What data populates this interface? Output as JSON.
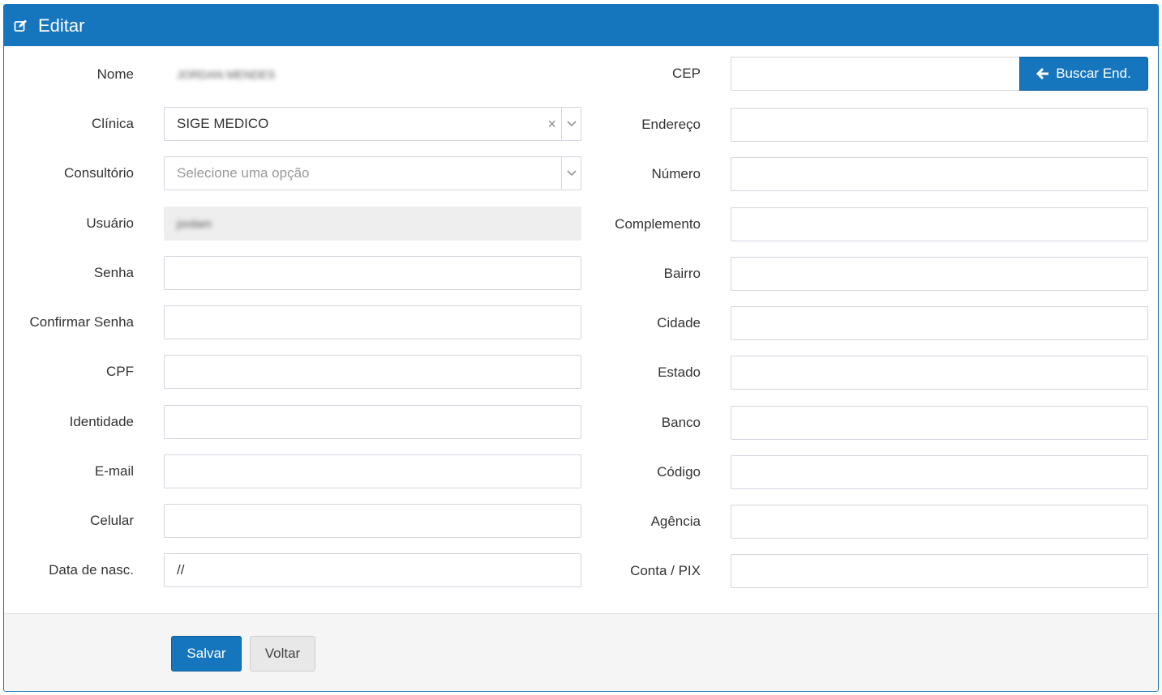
{
  "header": {
    "title": "Editar",
    "icon": "edit-icon"
  },
  "left_fields": [
    {
      "label": "Nome",
      "value": "JORDAN MENDES",
      "type": "text",
      "blurred": true
    },
    {
      "label": "Clínica",
      "value": "SIGE MEDICO",
      "type": "select",
      "clearable": true
    },
    {
      "label": "Consultório",
      "placeholder": "Selecione uma opção",
      "type": "select"
    },
    {
      "label": "Usuário",
      "value": "jordam",
      "type": "readonly",
      "blurred": true
    },
    {
      "label": "Senha",
      "value": "",
      "type": "password"
    },
    {
      "label": "Confirmar Senha",
      "value": "",
      "type": "password"
    },
    {
      "label": "CPF",
      "value": "",
      "type": "text"
    },
    {
      "label": "Identidade",
      "value": "",
      "type": "text"
    },
    {
      "label": "E-mail",
      "value": "",
      "type": "text"
    },
    {
      "label": "Celular",
      "value": "",
      "type": "text"
    },
    {
      "label": "Data de nasc.",
      "value": "//",
      "type": "text"
    }
  ],
  "right_fields": [
    {
      "label": "CEP",
      "value": "",
      "type": "cep"
    },
    {
      "label": "Endereço",
      "value": ""
    },
    {
      "label": "Número",
      "value": ""
    },
    {
      "label": "Complemento",
      "value": ""
    },
    {
      "label": "Bairro",
      "value": ""
    },
    {
      "label": "Cidade",
      "value": ""
    },
    {
      "label": "Estado",
      "value": ""
    },
    {
      "label": "Banco",
      "value": ""
    },
    {
      "label": "Código",
      "value": ""
    },
    {
      "label": "Agência",
      "value": ""
    },
    {
      "label": "Conta / PIX",
      "value": ""
    }
  ],
  "cep_button": {
    "label": "Buscar End.",
    "icon": "arrow-left-icon"
  },
  "footer": {
    "save_label": "Salvar",
    "back_label": "Voltar"
  },
  "colors": {
    "primary": "#1676bd",
    "border": "#d2d6de",
    "footer_bg": "#f5f5f5"
  }
}
